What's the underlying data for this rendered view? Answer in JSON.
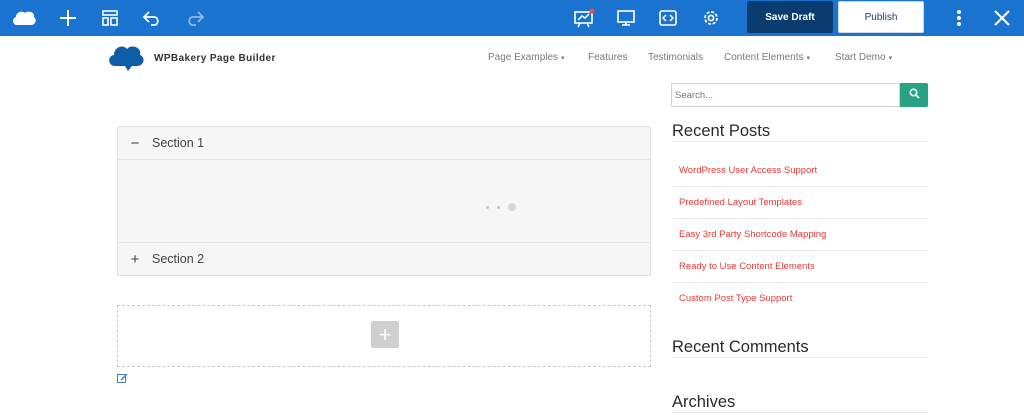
{
  "toolbar": {
    "icons": [
      "cloud-logo-icon",
      "add-element-icon",
      "templates-icon",
      "undo-icon",
      "redo-icon",
      "seo-icon",
      "responsive-preview-icon",
      "custom-css-icon",
      "settings-icon",
      "more-options-icon",
      "close-icon"
    ],
    "save_draft_label": "Save Draft",
    "publish_label": "Publish",
    "accent": "#1a73cf"
  },
  "site": {
    "brand_name": "WPBakery Page Builder",
    "nav": [
      {
        "label": "Page Examples",
        "has_caret": true
      },
      {
        "label": "Features",
        "has_caret": false
      },
      {
        "label": "Testimonials",
        "has_caret": false
      },
      {
        "label": "Content Elements",
        "has_caret": true
      },
      {
        "label": "Start Demo",
        "has_caret": true
      }
    ],
    "caret_glyph": "▾"
  },
  "main": {
    "accordion": {
      "sections": [
        {
          "title": "Section 1",
          "sign": "−"
        },
        {
          "title": "Section 2",
          "sign": "+"
        }
      ]
    },
    "add_glyph": "+"
  },
  "sidebar": {
    "search": {
      "placeholder": "Search...",
      "value": ""
    },
    "recent_posts_title": "Recent Posts",
    "recent_posts": [
      "WordPress User Access Support",
      "Predefined Layout Templates",
      "Easy 3rd Party Shortcode Mapping",
      "Ready to Use Content Elements",
      "Custom Post Type Support"
    ],
    "recent_comments_title": "Recent Comments",
    "archives_title": "Archives",
    "link_color": "#e53935"
  }
}
